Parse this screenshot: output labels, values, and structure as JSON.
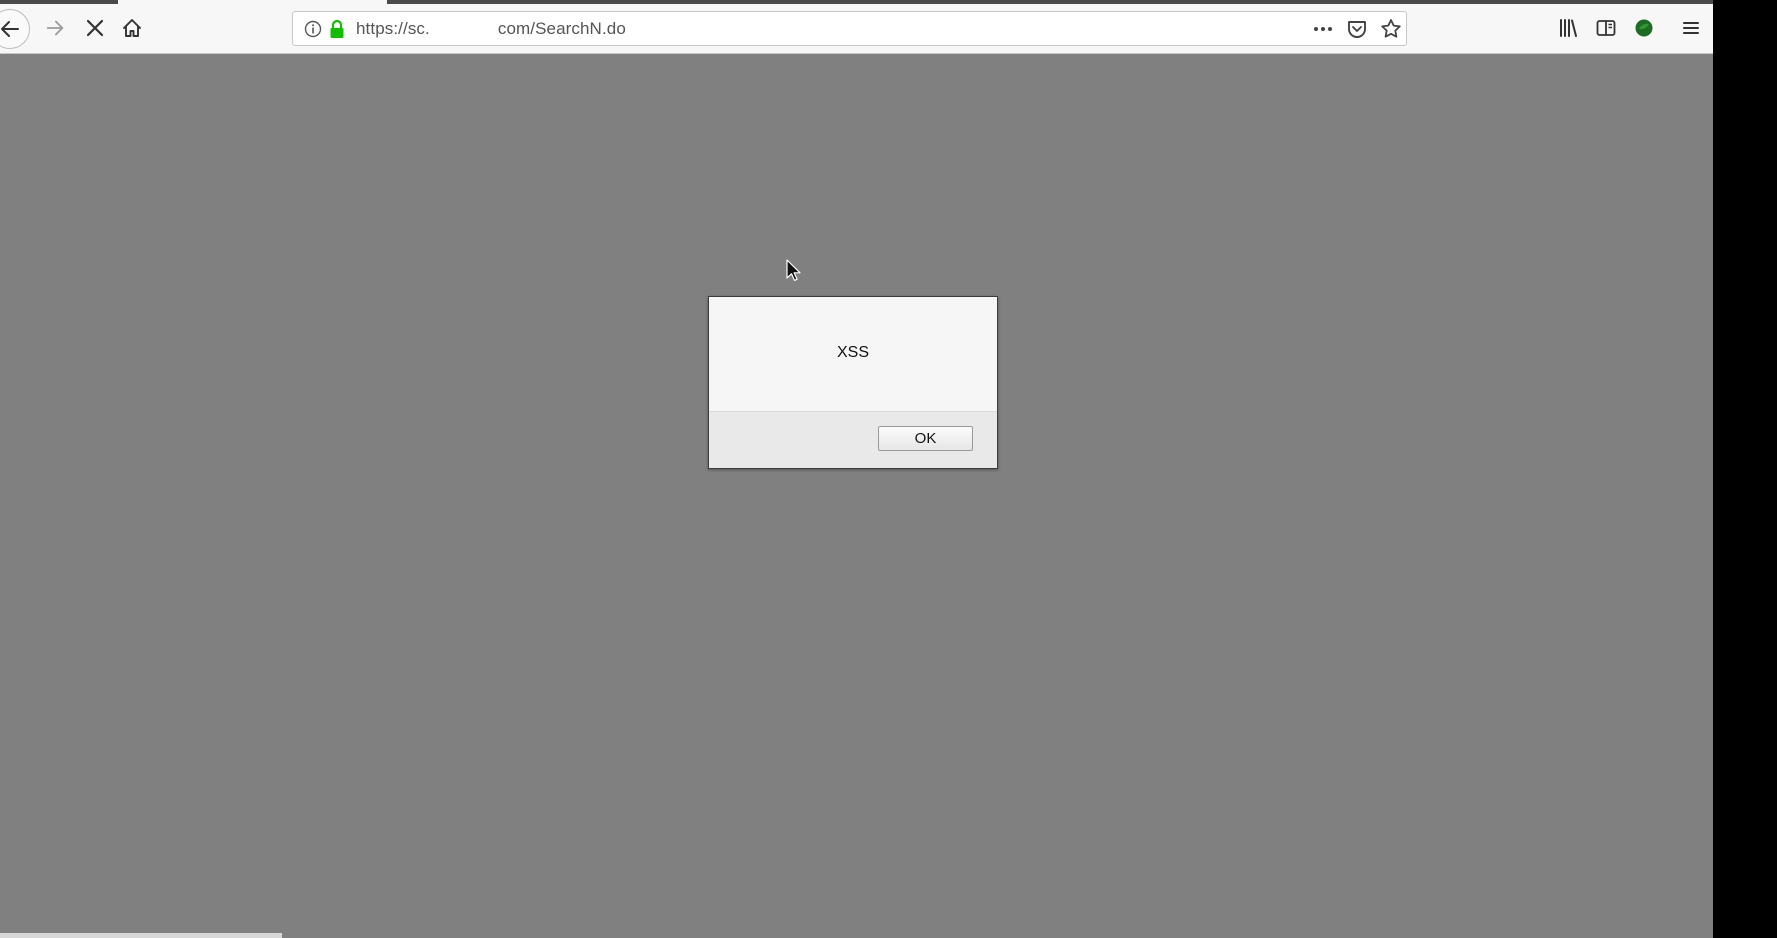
{
  "browser": {
    "url_prefix": "https://sc.",
    "url_suffix": "com/SearchN.do",
    "icons": {
      "back": "back-arrow-icon",
      "forward": "forward-arrow-icon",
      "stop": "close-icon",
      "home": "home-icon",
      "info": "info-icon",
      "lock": "lock-icon",
      "page_actions": "more-horizontal-icon",
      "pocket": "pocket-icon",
      "bookmark": "star-icon",
      "library": "library-icon",
      "sidebar": "sidebar-icon",
      "extension": "extension-icon",
      "menu": "hamburger-icon"
    },
    "colors": {
      "lock": "#12bc00",
      "content_overlay": "#808080"
    }
  },
  "alert": {
    "message": "XSS",
    "ok_label": "OK"
  }
}
